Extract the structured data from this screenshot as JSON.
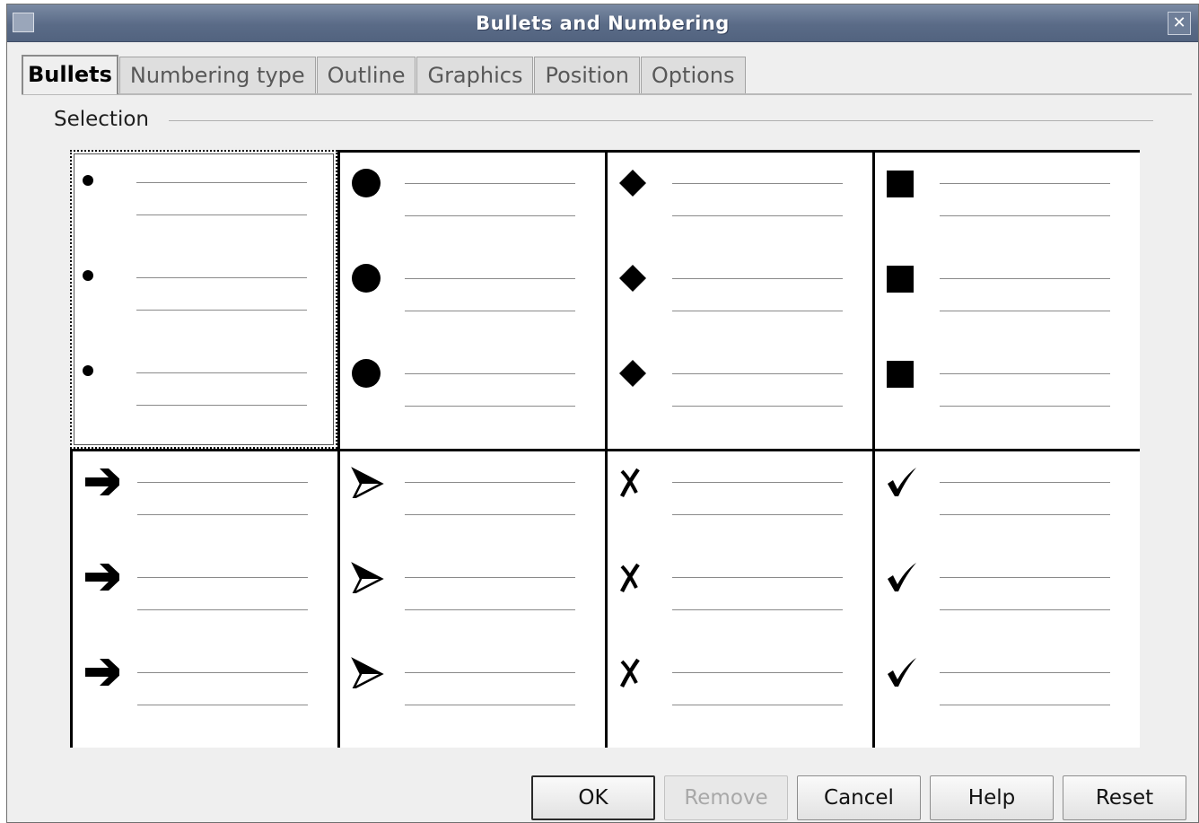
{
  "window": {
    "title": "Bullets and Numbering",
    "close_glyph": "✕"
  },
  "tabs": [
    {
      "label": "Bullets",
      "active": true
    },
    {
      "label": "Numbering type",
      "active": false
    },
    {
      "label": "Outline",
      "active": false
    },
    {
      "label": "Graphics",
      "active": false
    },
    {
      "label": "Position",
      "active": false
    },
    {
      "label": "Options",
      "active": false
    }
  ],
  "selection_group": {
    "label": "Selection",
    "styles": [
      {
        "name": "small-dot-bullet",
        "icon": "dot-icon",
        "selected": true
      },
      {
        "name": "large-dot-bullet",
        "icon": "large-dot-icon",
        "selected": false
      },
      {
        "name": "diamond-bullet",
        "icon": "diamond-icon",
        "selected": false
      },
      {
        "name": "square-bullet",
        "icon": "square-icon",
        "selected": false
      },
      {
        "name": "arrow-bullet",
        "icon": "arrow-icon",
        "selected": false
      },
      {
        "name": "arrowhead-bullet",
        "icon": "arrowhead-icon",
        "selected": false
      },
      {
        "name": "cross-bullet",
        "icon": "cross-icon",
        "selected": false
      },
      {
        "name": "check-bullet",
        "icon": "check-icon",
        "selected": false
      }
    ]
  },
  "buttons": {
    "ok": "OK",
    "remove": "Remove",
    "cancel": "Cancel",
    "help": "Help",
    "reset": "Reset"
  },
  "colors": {
    "titlebar": "#5a6b87",
    "dialog_bg": "#efefef"
  }
}
